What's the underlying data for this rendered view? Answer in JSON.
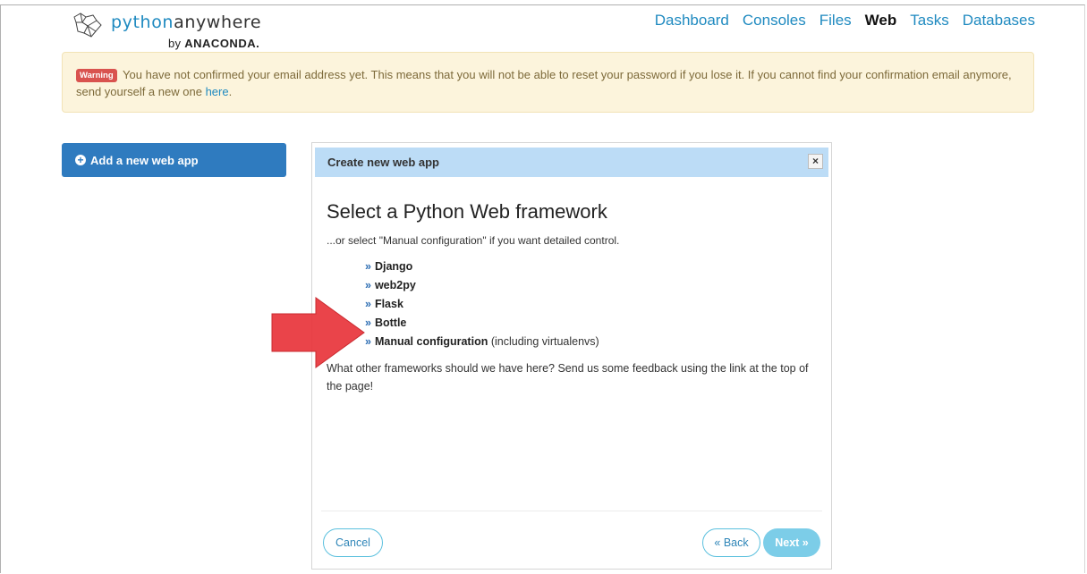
{
  "brand": {
    "name_part1": "python",
    "name_part2": "anywhere",
    "by": "by",
    "company": "ANACONDA."
  },
  "nav": {
    "items": [
      {
        "label": "Dashboard",
        "active": false
      },
      {
        "label": "Consoles",
        "active": false
      },
      {
        "label": "Files",
        "active": false
      },
      {
        "label": "Web",
        "active": true
      },
      {
        "label": "Tasks",
        "active": false
      },
      {
        "label": "Databases",
        "active": false
      }
    ]
  },
  "warning": {
    "badge": "Warning",
    "text": "You have not confirmed your email address yet. This means that you will not be able to reset your password if you lose it. If you cannot find your confirmation email anymore, send yourself a new one",
    "link_text": "here",
    "trailing": "."
  },
  "sidebar": {
    "add_button_label": "Add a new web app"
  },
  "modal": {
    "header": "Create new web app",
    "close_icon": "×",
    "title": "Select a Python Web framework",
    "subtitle": "...or select \"Manual configuration\" if you want detailed control.",
    "bullet": "»",
    "frameworks": [
      {
        "name": "Django",
        "note": ""
      },
      {
        "name": "web2py",
        "note": ""
      },
      {
        "name": "Flask",
        "note": ""
      },
      {
        "name": "Bottle",
        "note": ""
      },
      {
        "name": "Manual configuration",
        "note": "(including virtualenvs)"
      }
    ],
    "feedback": "What other frameworks should we have here? Send us some feedback using the link at the top of the page!",
    "cancel_label": "Cancel",
    "back_label": "« Back",
    "next_label": "Next »"
  },
  "colors": {
    "accent": "#1f8ac0",
    "primary_button": "#2f7bbf",
    "modal_header": "#bcdcf6",
    "warning_bg": "#fcf4dc",
    "annotation_arrow": "#e8363c"
  }
}
